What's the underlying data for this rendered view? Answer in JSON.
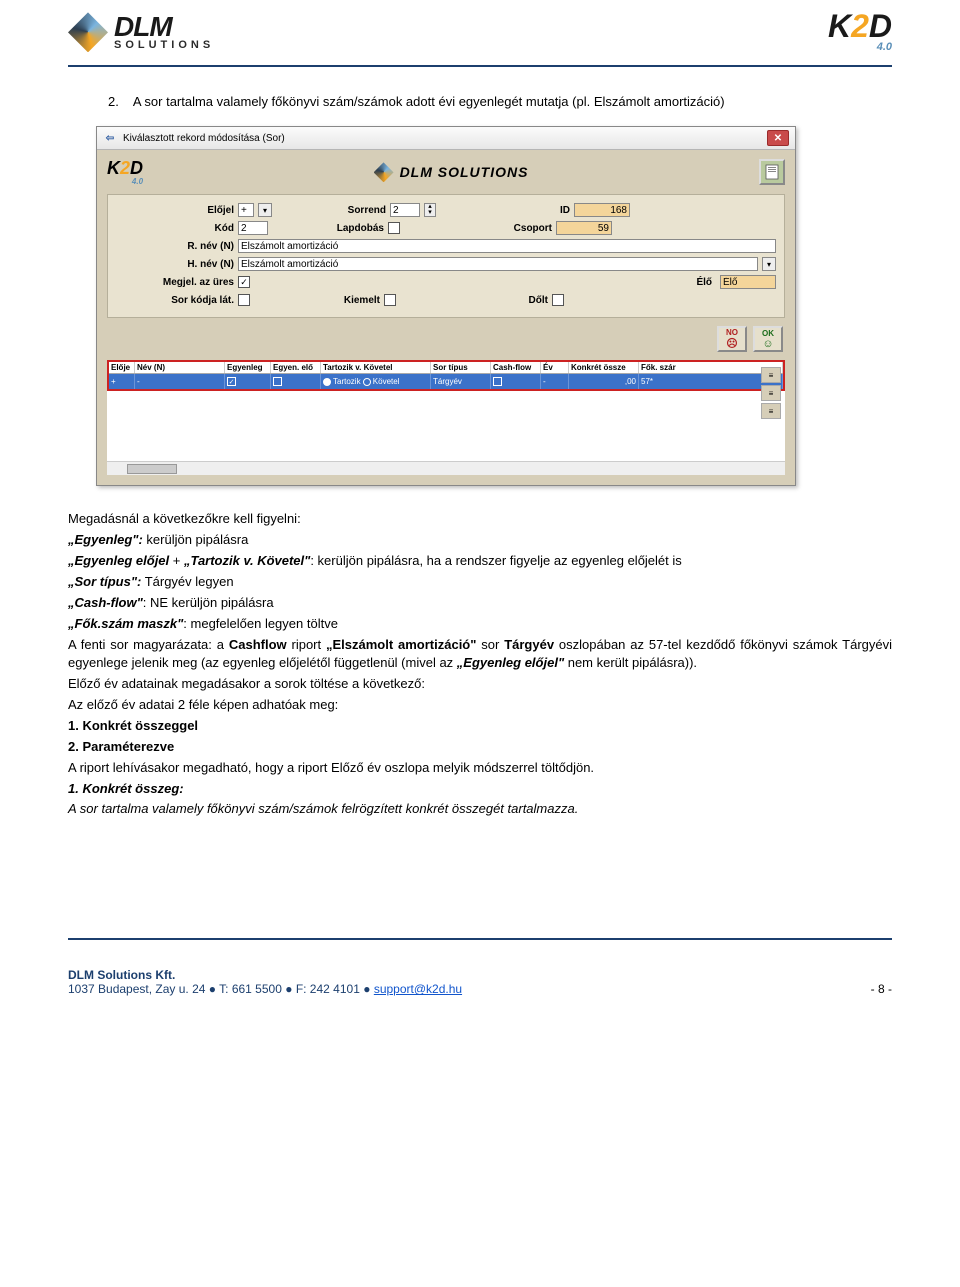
{
  "header": {
    "dlm_brand": "DLM",
    "dlm_sub": "SOLUTIONS",
    "k2d_brand_pre": "K",
    "k2d_brand_mid": "2",
    "k2d_brand_post": "D",
    "k2d_version": "4.0"
  },
  "intro": {
    "num": "2.",
    "text": "A sor tartalma valamely főkönyvi szám/számok adott évi egyenlegét mutatja (pl. Elszámolt amortizáció)"
  },
  "dialog": {
    "title": "Kiválasztott rekord módosítása (Sor)",
    "fields": {
      "elojel_label": "Előjel",
      "elojel_value": "+",
      "sorrend_label": "Sorrend",
      "sorrend_value": "2",
      "id_label": "ID",
      "id_value": "168",
      "kod_label": "Kód",
      "kod_value": "2",
      "lapdobas_label": "Lapdobás",
      "csoport_label": "Csoport",
      "csoport_value": "59",
      "rnev_label": "R. név (N)",
      "rnev_value": "Elszámolt amortizáció",
      "hnev_label": "H. név (N)",
      "hnev_value": "Elszámolt amortizáció",
      "megjel_label": "Megjel. az üres",
      "elo_label": "Élő",
      "elo_value": "Élő",
      "sorkodja_label": "Sor kódja lát.",
      "kiemelt_label": "Kiemelt",
      "dolt_label": "Dőlt"
    },
    "buttons": {
      "no": "NO",
      "ok": "OK"
    },
    "grid": {
      "headers": [
        "Elője",
        "Név (N)",
        "Egyenleg",
        "Egyen. elő",
        "Tartozik v. Követel",
        "Sor típus",
        "Cash-flow",
        "Év",
        "Konkrét össze",
        "Fők. szár"
      ],
      "row": {
        "elojel": "+",
        "nev": "-",
        "egyenleg_checked": "✓",
        "tartozik": "Tartozik",
        "kovetel": "Követel",
        "sortipus": "Tárgyév",
        "ev": "-",
        "konkret": ",00",
        "fok": "57*"
      }
    }
  },
  "body": {
    "lead": "Megadásnál a következőkre kell figyelni:",
    "l1a": "„Egyenleg\":",
    "l1b": " kerüljön pipálásra",
    "l2a": "„Egyenleg előjel",
    "l2b": " + ",
    "l2c": "„Tartozik v. Követel\"",
    "l2d": ": kerüljön pipálásra, ha a rendszer figyelje az egyenleg előjelét is",
    "l3a": "„Sor típus\":",
    "l3b": " Tárgyév legyen",
    "l4a": "„Cash-flow\"",
    "l4b": ": NE kerüljön pipálásra",
    "l5a": "„Fők.szám maszk\"",
    "l5b": ": megfelelően legyen töltve",
    "exp1": "A fenti sor magyarázata: a ",
    "exp2": "Cashflow",
    "exp3": " riport ",
    "exp4": "„Elszámolt amortizáció\"",
    "exp5": " sor ",
    "exp6": "Tárgyév",
    "exp7": " oszlopában az 57-tel kezdődő főkönyvi számok Tárgyévi egyenlege jelenik meg (az egyenleg előjelétől függetlenül (mivel az ",
    "exp8": "„Egyenleg előjel\"",
    "exp9": " nem került pipálásra)).",
    "p2": "Előző év adatainak megadásakor a sorok töltése a következő:",
    "p3": "Az előző év adatai 2 féle képen adhatóak meg:",
    "li1": "1. Konkrét összeggel",
    "li2": "2. Paraméterezve",
    "p4": "A riport lehívásakor megadható, hogy a riport Előző év oszlopa melyik módszerrel töltődjön.",
    "h1": "1. Konkrét összeg:",
    "h1b": "A sor tartalma valamely főkönyvi szám/számok felrögzített konkrét összegét tartalmazza."
  },
  "footer": {
    "company": "DLM Solutions Kft.",
    "addr": "1037 Budapest, Zay u. 24",
    "tel": "T: 661 5500",
    "fax": "F: 242 4101",
    "email": "support@k2d.hu",
    "page": "- 8 -"
  }
}
